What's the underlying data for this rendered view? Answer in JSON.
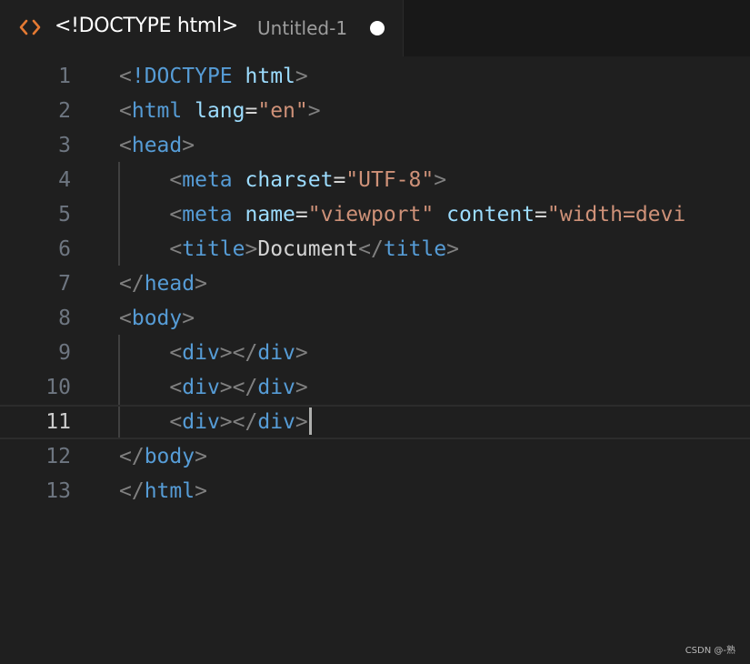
{
  "tab": {
    "icon": "html-brackets-icon",
    "title": "<!DOCTYPE html>",
    "description": "Untitled-1",
    "dirty_indicator": "unsaved-dot"
  },
  "editor": {
    "current_line": 11,
    "lines": [
      {
        "n": "1",
        "tokens": [
          [
            "p",
            "<"
          ],
          [
            "t",
            "!DOCTYPE"
          ],
          [
            "p",
            " "
          ],
          [
            "a",
            "html"
          ],
          [
            "p",
            ">"
          ]
        ]
      },
      {
        "n": "2",
        "tokens": [
          [
            "p",
            "<"
          ],
          [
            "t",
            "html"
          ],
          [
            "p",
            " "
          ],
          [
            "a",
            "lang"
          ],
          [
            "e",
            "="
          ],
          [
            "s",
            "\"en\""
          ],
          [
            "p",
            ">"
          ]
        ]
      },
      {
        "n": "3",
        "tokens": [
          [
            "p",
            "<"
          ],
          [
            "t",
            "head"
          ],
          [
            "p",
            ">"
          ]
        ]
      },
      {
        "n": "4",
        "tokens": [
          [
            "p",
            "    <"
          ],
          [
            "t",
            "meta"
          ],
          [
            "p",
            " "
          ],
          [
            "a",
            "charset"
          ],
          [
            "e",
            "="
          ],
          [
            "s",
            "\"UTF-8\""
          ],
          [
            "p",
            ">"
          ]
        ]
      },
      {
        "n": "5",
        "tokens": [
          [
            "p",
            "    <"
          ],
          [
            "t",
            "meta"
          ],
          [
            "p",
            " "
          ],
          [
            "a",
            "name"
          ],
          [
            "e",
            "="
          ],
          [
            "s",
            "\"viewport\""
          ],
          [
            "p",
            " "
          ],
          [
            "a",
            "content"
          ],
          [
            "e",
            "="
          ],
          [
            "s",
            "\"width=devi"
          ]
        ]
      },
      {
        "n": "6",
        "tokens": [
          [
            "p",
            "    <"
          ],
          [
            "t",
            "title"
          ],
          [
            "p",
            ">"
          ],
          [
            "x",
            "Document"
          ],
          [
            "p",
            "</"
          ],
          [
            "t",
            "title"
          ],
          [
            "p",
            ">"
          ]
        ]
      },
      {
        "n": "7",
        "tokens": [
          [
            "p",
            "</"
          ],
          [
            "t",
            "head"
          ],
          [
            "p",
            ">"
          ]
        ]
      },
      {
        "n": "8",
        "tokens": [
          [
            "p",
            "<"
          ],
          [
            "t",
            "body"
          ],
          [
            "p",
            ">"
          ]
        ]
      },
      {
        "n": "9",
        "tokens": [
          [
            "p",
            "    <"
          ],
          [
            "t",
            "div"
          ],
          [
            "p",
            "></"
          ],
          [
            "t",
            "div"
          ],
          [
            "p",
            ">"
          ]
        ]
      },
      {
        "n": "10",
        "tokens": [
          [
            "p",
            "    <"
          ],
          [
            "t",
            "div"
          ],
          [
            "p",
            "></"
          ],
          [
            "t",
            "div"
          ],
          [
            "p",
            ">"
          ]
        ]
      },
      {
        "n": "11",
        "tokens": [
          [
            "p",
            "    <"
          ],
          [
            "t",
            "div"
          ],
          [
            "p",
            "></"
          ],
          [
            "t",
            "div"
          ],
          [
            "p",
            ">"
          ]
        ]
      },
      {
        "n": "12",
        "tokens": [
          [
            "p",
            "</"
          ],
          [
            "t",
            "body"
          ],
          [
            "p",
            ">"
          ]
        ]
      },
      {
        "n": "13",
        "tokens": [
          [
            "p",
            "</"
          ],
          [
            "t",
            "html"
          ],
          [
            "p",
            ">"
          ]
        ]
      }
    ]
  },
  "colors": {
    "background": "#1f1f1f",
    "tab_icon": "#e37933",
    "tag": "#569cd6",
    "attribute": "#9cdcfe",
    "string": "#ce9178",
    "punctuation": "#808080"
  },
  "watermark": "CSDN @-熟"
}
